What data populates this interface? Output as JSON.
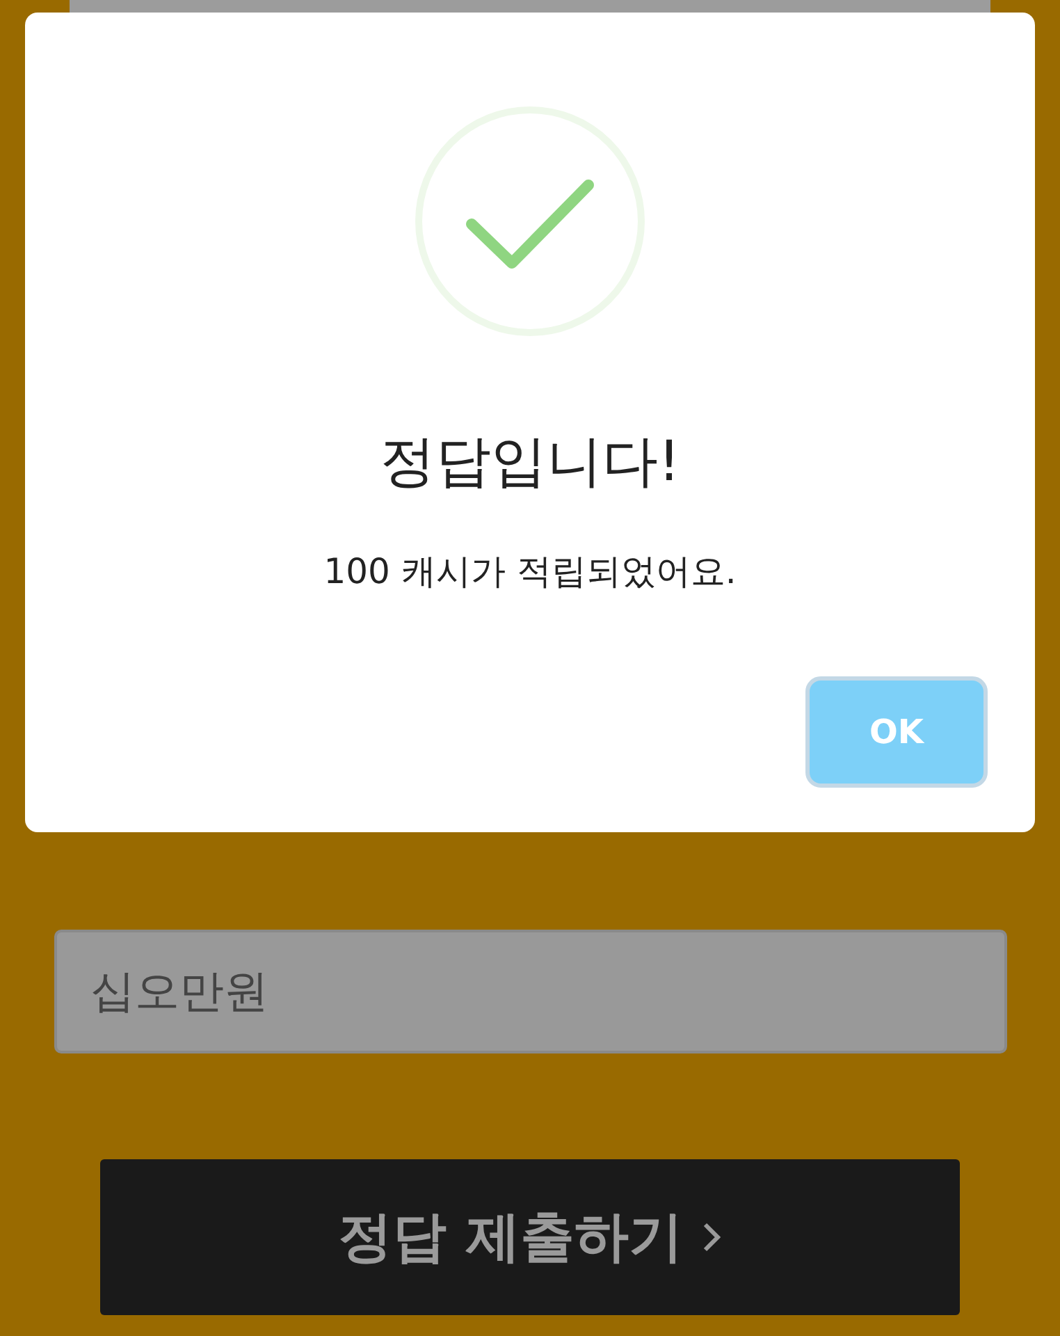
{
  "dialog": {
    "title": "정답입니다!",
    "message": "100 캐시가 적립되었어요.",
    "buttons": [
      "OK"
    ]
  },
  "answer_field": {
    "value": "십오만원"
  },
  "submit_button": {
    "label": "정답 제출하기"
  }
}
